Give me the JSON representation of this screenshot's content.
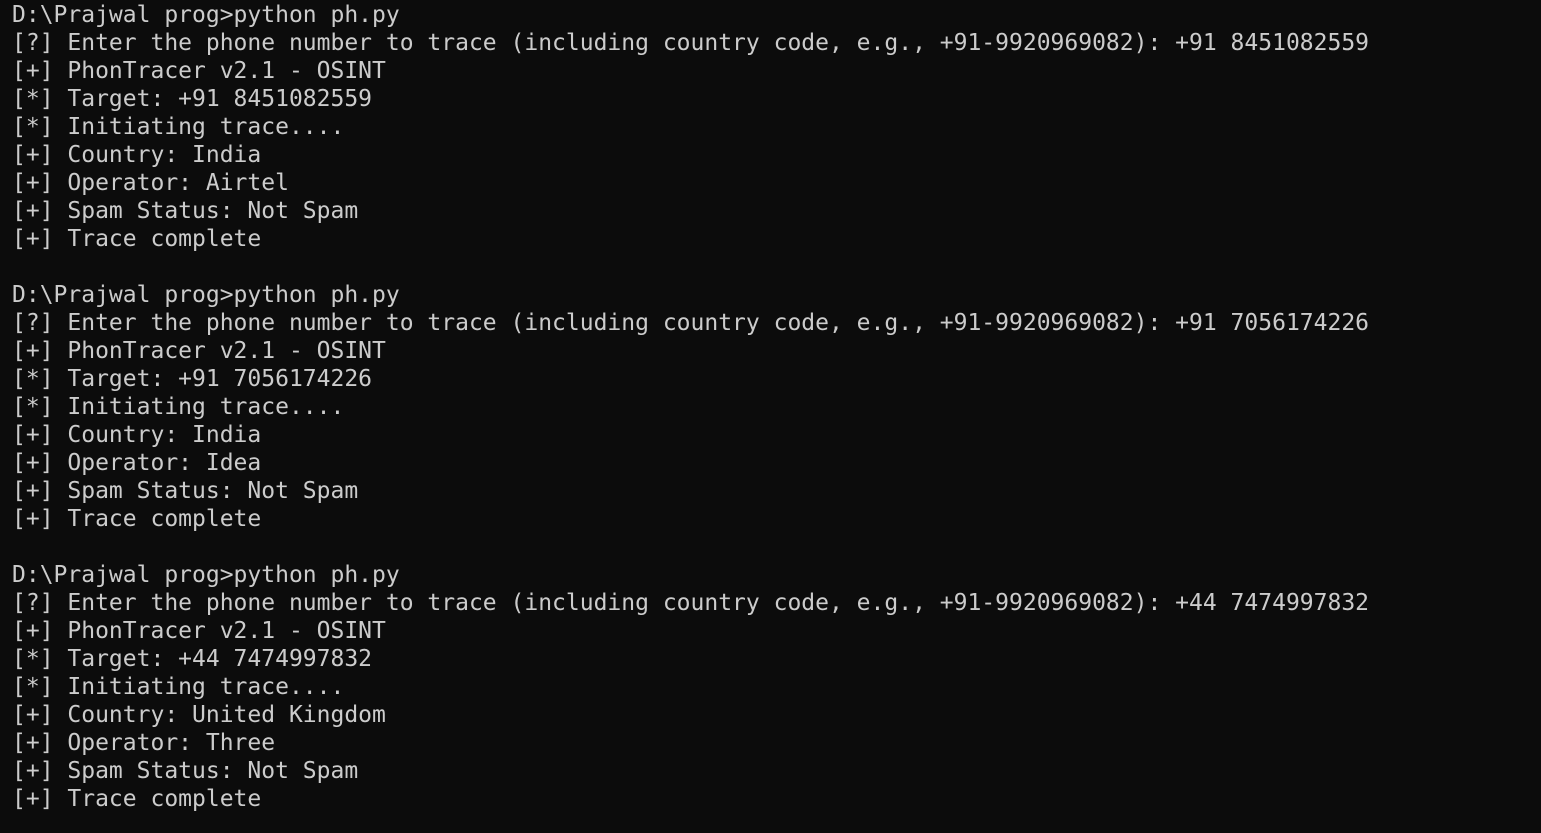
{
  "colors": {
    "background": "#0c0c0c",
    "foreground": "#cccccc"
  },
  "runs": [
    {
      "command": "D:\\Prajwal prog>python ph.py",
      "prompt": "[?] Enter the phone number to trace (including country code, e.g., +91-9920969082): +91 8451082559",
      "banner": "[+] PhonTracer v2.1 - OSINT",
      "target": "[*] Target: +91 8451082559",
      "initiating": "[*] Initiating trace....",
      "country": "[+] Country: India",
      "operator": "[+] Operator: Airtel",
      "spam": "[+] Spam Status: Not Spam",
      "complete": "[+] Trace complete"
    },
    {
      "command": "D:\\Prajwal prog>python ph.py",
      "prompt": "[?] Enter the phone number to trace (including country code, e.g., +91-9920969082): +91 7056174226",
      "banner": "[+] PhonTracer v2.1 - OSINT",
      "target": "[*] Target: +91 7056174226",
      "initiating": "[*] Initiating trace....",
      "country": "[+] Country: India",
      "operator": "[+] Operator: Idea",
      "spam": "[+] Spam Status: Not Spam",
      "complete": "[+] Trace complete"
    },
    {
      "command": "D:\\Prajwal prog>python ph.py",
      "prompt": "[?] Enter the phone number to trace (including country code, e.g., +91-9920969082): +44 7474997832",
      "banner": "[+] PhonTracer v2.1 - OSINT",
      "target": "[*] Target: +44 7474997832",
      "initiating": "[*] Initiating trace....",
      "country": "[+] Country: United Kingdom",
      "operator": "[+] Operator: Three",
      "spam": "[+] Spam Status: Not Spam",
      "complete": "[+] Trace complete"
    }
  ]
}
